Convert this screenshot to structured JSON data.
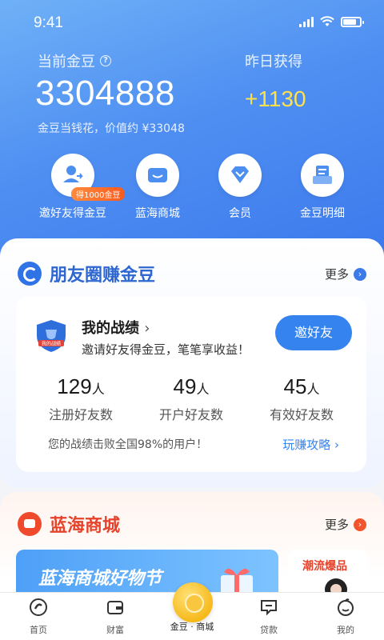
{
  "status_bar": {
    "time": "9:41"
  },
  "header": {
    "current_label": "当前金豆",
    "current_value": "3304888",
    "value_text": "金豆当钱花，价值约 ¥33048",
    "yesterday_label": "昨日获得",
    "yesterday_value": "+1130"
  },
  "shortcuts": [
    {
      "label": "邀好友得金豆",
      "tag": "得1000金豆",
      "icon": "invite-friend-icon"
    },
    {
      "label": "蓝海商城",
      "icon": "store-icon"
    },
    {
      "label": "会员",
      "icon": "diamond-icon"
    },
    {
      "label": "金豆明细",
      "icon": "bill-detail-icon"
    }
  ],
  "friends_section": {
    "title": "朋友圈赚金豆",
    "more": "更多",
    "record": {
      "title": "我的战绩",
      "subtitle": "邀请好友得金豆，笔笔享收益！",
      "badge_text": "我的战绩",
      "invite_button": "邀好友",
      "stats": [
        {
          "value": "129",
          "unit": "人",
          "label": "注册好友数"
        },
        {
          "value": "49",
          "unit": "人",
          "label": "开户好友数"
        },
        {
          "value": "45",
          "unit": "人",
          "label": "有效好友数"
        }
      ],
      "rank_text": "您的战绩击败全国98%的用户！",
      "strategy_link": "玩赚攻略 ›"
    }
  },
  "mall_section": {
    "title": "蓝海商城",
    "more": "更多",
    "banner_text": "蓝海商城好物节",
    "side_title": "潮流爆品"
  },
  "tabbar": [
    {
      "label": "首页",
      "icon": "home-icon"
    },
    {
      "label": "财富",
      "icon": "wallet-icon"
    },
    {
      "label": "金豆 · 商城",
      "icon": "coin-icon"
    },
    {
      "label": "贷款",
      "icon": "loan-icon"
    },
    {
      "label": "我的",
      "icon": "profile-icon"
    }
  ],
  "colors": {
    "primary": "#3583ef",
    "accent_yellow": "#ffe24a",
    "mall_red": "#e5432b"
  }
}
